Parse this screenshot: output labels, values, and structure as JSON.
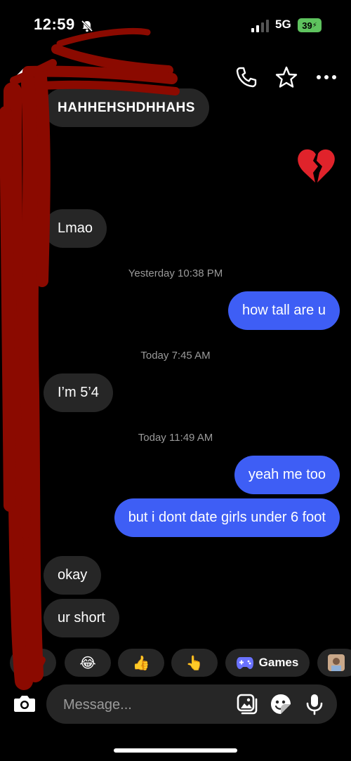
{
  "status_bar": {
    "time": "12:59",
    "network": "5G",
    "battery": "39"
  },
  "header": {
    "icons": [
      "phone-icon",
      "star-icon",
      "more-icon"
    ]
  },
  "messages": [
    {
      "side": "in",
      "text": "HAHHEHSHDHHAHS"
    },
    {
      "side": "out",
      "text": "💔",
      "kind": "emoji"
    },
    {
      "side": "in",
      "text": "Lmao"
    },
    {
      "kind": "timestamp",
      "text": "Yesterday 10:38 PM"
    },
    {
      "side": "out",
      "text": "how tall are u"
    },
    {
      "kind": "timestamp",
      "text": "Today 7:45 AM"
    },
    {
      "side": "in",
      "text": "I’m 5’4"
    },
    {
      "kind": "timestamp",
      "text": "Today 11:49 AM"
    },
    {
      "side": "out",
      "text": "yeah me too"
    },
    {
      "side": "out",
      "text": "but i dont date girls under 6 foot"
    },
    {
      "side": "in",
      "text": "okay"
    },
    {
      "side": "in",
      "text": "ur short"
    }
  ],
  "quick_reactions": {
    "items": [
      "❤️",
      "😂",
      "👍",
      "👆"
    ],
    "games_label": "Games"
  },
  "composer": {
    "placeholder": "Message..."
  },
  "colors": {
    "outgoing": "#3e5ef5",
    "incoming": "#262626",
    "background": "#000000",
    "redaction": "#8b0a00"
  }
}
